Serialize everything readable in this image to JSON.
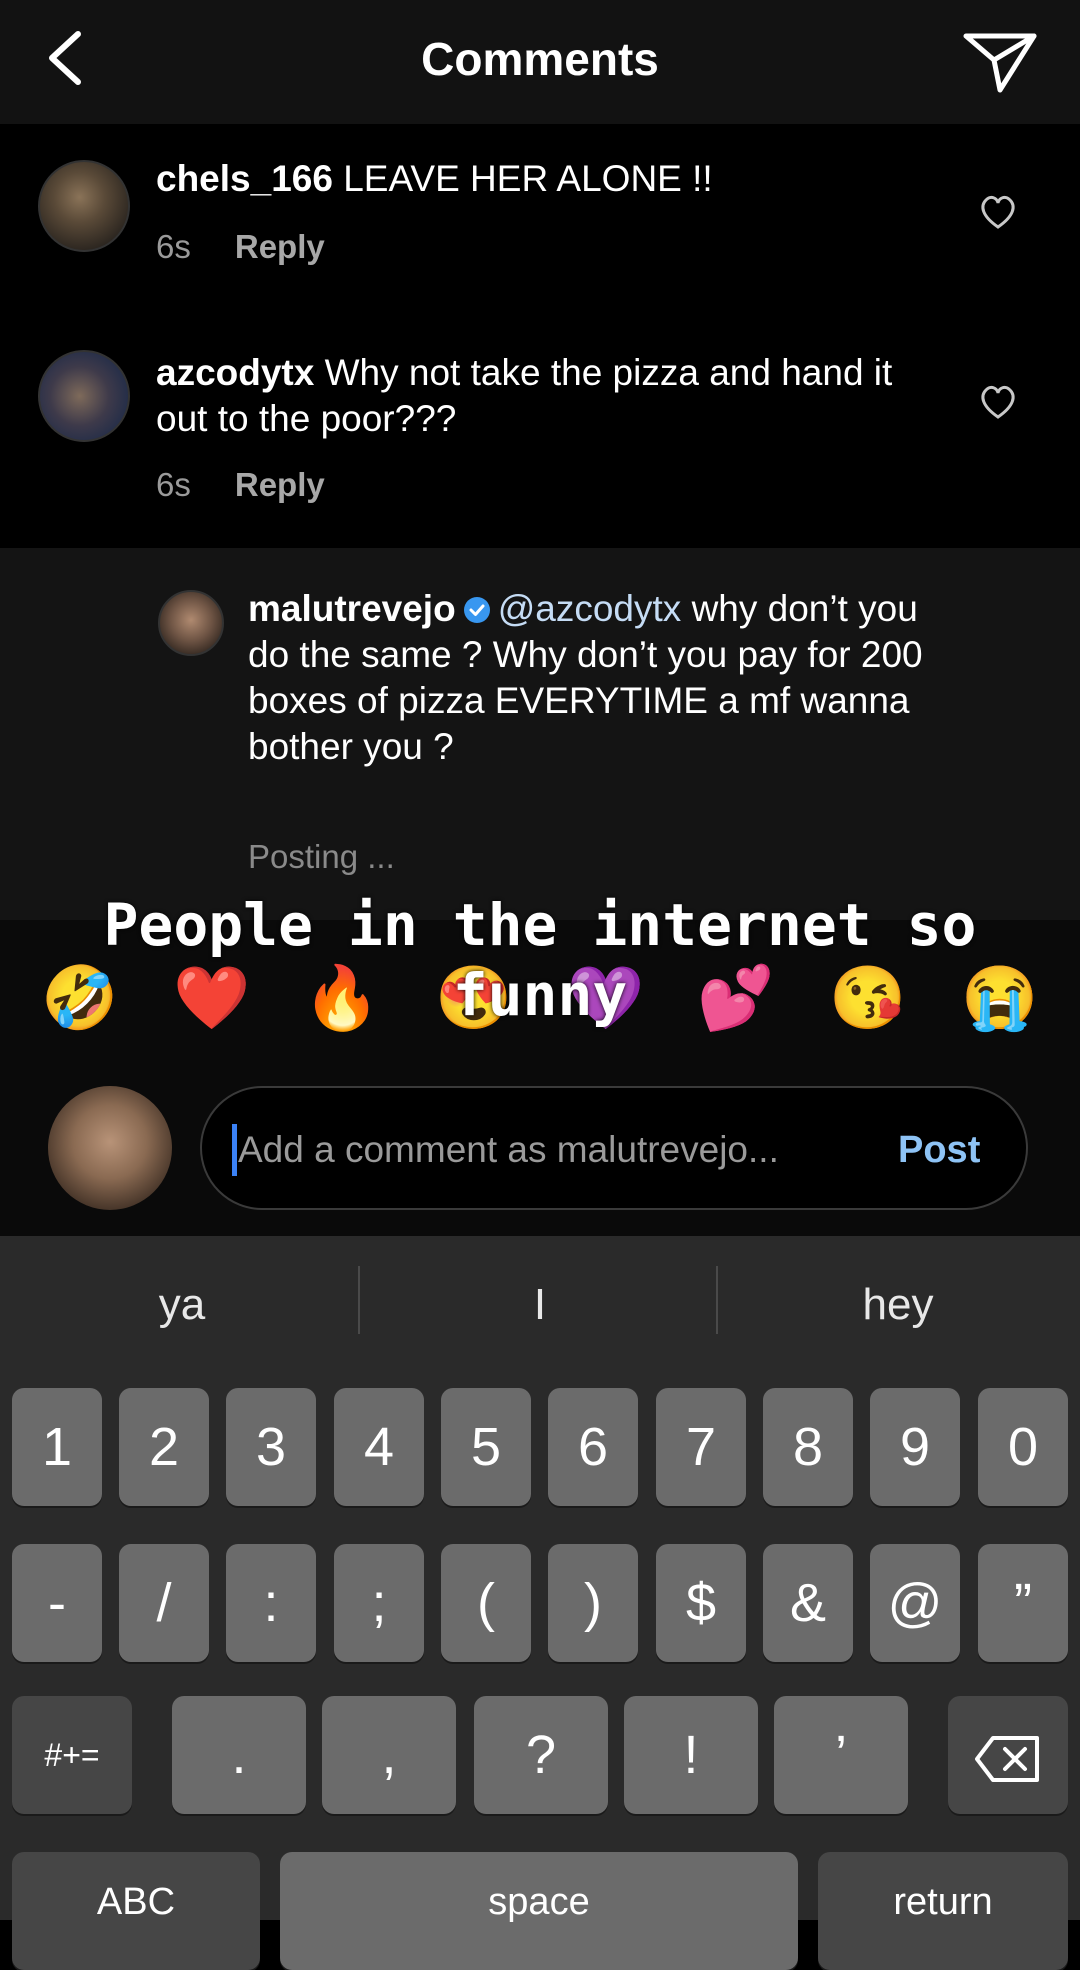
{
  "header": {
    "title": "Comments"
  },
  "comments": [
    {
      "username": "chels_166",
      "text": "LEAVE HER ALONE !!",
      "time": "6s",
      "reply": "Reply"
    },
    {
      "username": "azcodytx",
      "text": "Why not take the pizza and hand it out to the poor???",
      "time": "6s",
      "reply": "Reply"
    },
    {
      "username": "malutrevejo",
      "mention": "@azcodytx",
      "text": "why don’t you do the same ? Why don’t you pay for 200 boxes of pizza EVERYTIME a mf wanna bother you ?",
      "status": "Posting ..."
    }
  ],
  "caption": "People in the internet so funny",
  "emoji_bar": [
    "🤣",
    "❤️",
    "🔥",
    "😍",
    "💜",
    "💕",
    "😘",
    "😭"
  ],
  "input": {
    "placeholder": "Add a comment as malutrevejo...",
    "post": "Post"
  },
  "keyboard": {
    "suggestions": [
      "ya",
      "I",
      "hey"
    ],
    "row1": [
      "1",
      "2",
      "3",
      "4",
      "5",
      "6",
      "7",
      "8",
      "9",
      "0"
    ],
    "row2": [
      "-",
      "/",
      ":",
      ";",
      "(",
      ")",
      "$",
      "&",
      "@",
      "”"
    ],
    "row3": [
      "#+=",
      ".",
      ",",
      "?",
      "!",
      "’"
    ],
    "row4": [
      "ABC",
      "space",
      "return"
    ]
  },
  "colors": {
    "accent_blue": "#3897f0",
    "post_blue": "#8ec3f5",
    "background": "#000000"
  },
  "icons": [
    "back-arrow-icon",
    "send-icon",
    "heart-icon",
    "verified-badge-icon",
    "backspace-icon"
  ]
}
